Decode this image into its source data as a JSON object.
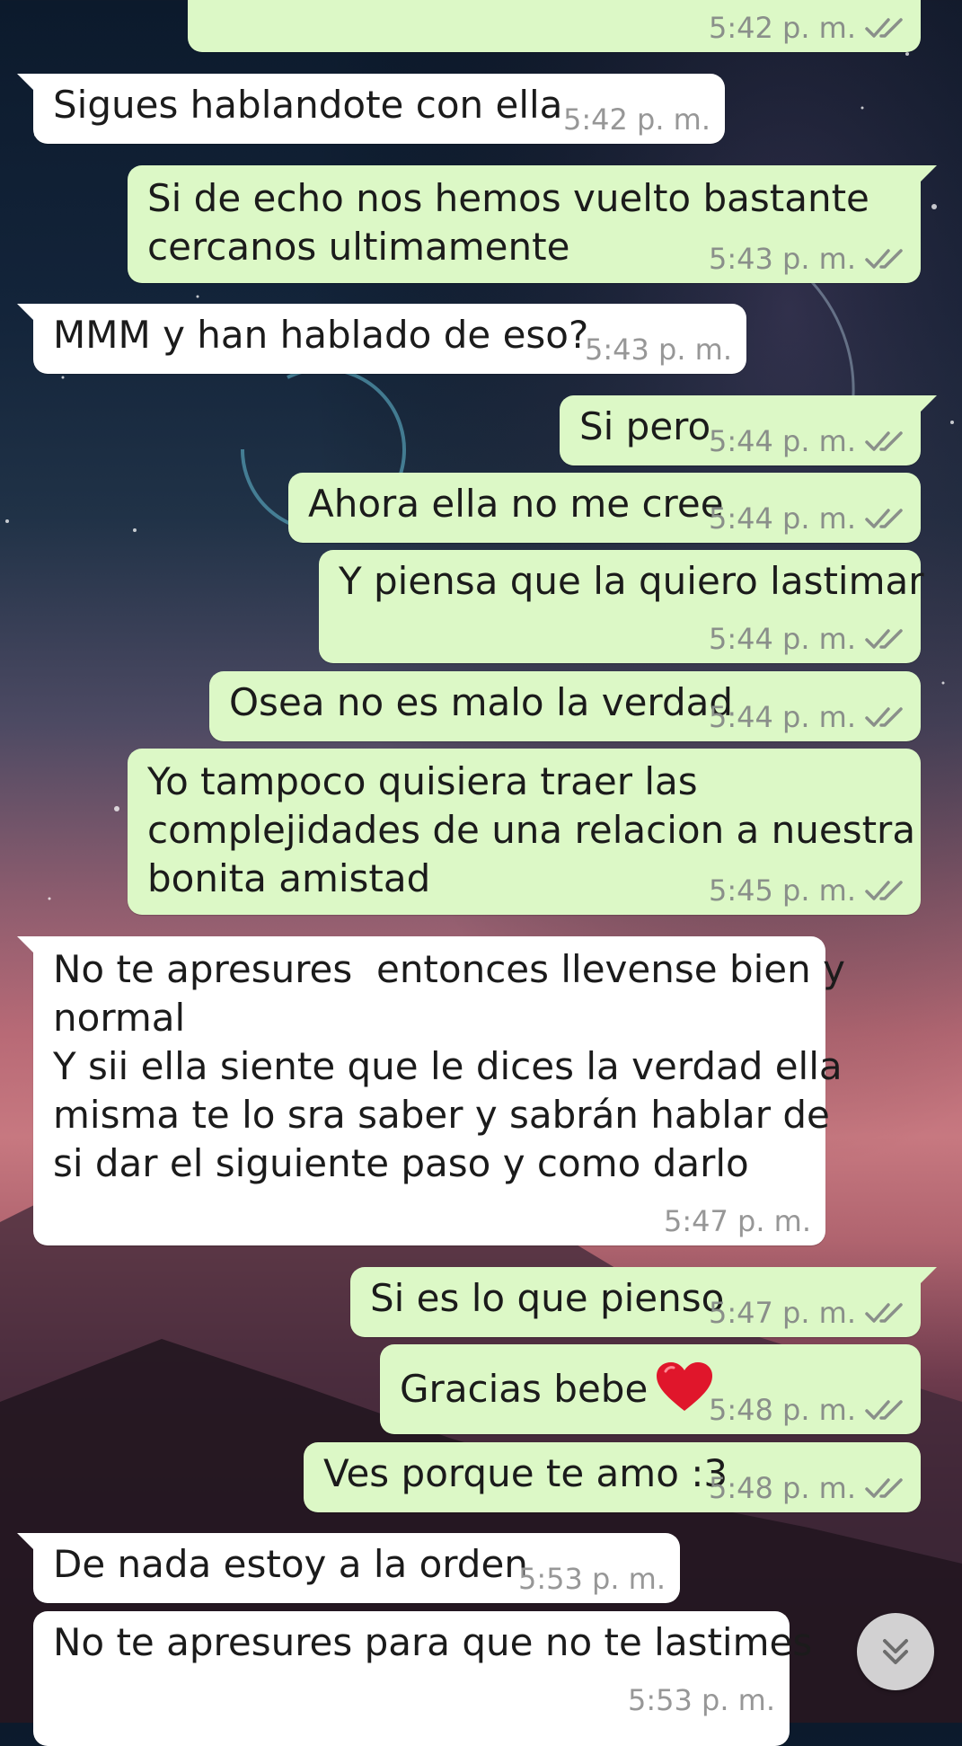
{
  "messages": [
    {
      "text": "",
      "time": "5:42 p. m."
    },
    {
      "text": "Sigues hablandote con ella",
      "time": "5:42 p. m."
    },
    {
      "text": "Si de echo nos hemos vuelto bastante\ncercanos ultimamente",
      "time": "5:43 p. m."
    },
    {
      "text": "MMM y han hablado de eso?",
      "time": "5:43 p. m."
    },
    {
      "text": "Si pero",
      "time": "5:44 p. m."
    },
    {
      "text": "Ahora ella no me cree",
      "time": "5:44 p. m."
    },
    {
      "text": "Y piensa que la quiero lastimar",
      "time": "5:44 p. m."
    },
    {
      "text": "Osea no es malo la verdad",
      "time": "5:44 p. m."
    },
    {
      "text": "Yo tampoco quisiera traer las\ncomplejidades de una relacion a nuestra\nbonita amistad",
      "time": "5:45 p. m."
    },
    {
      "text": "No te apresures  entonces llevense bien y\nnormal\nY sii ella siente que le dices la verdad ella\nmisma te lo sra saber y sabrán hablar de\nsi dar el siguiente paso y como darlo",
      "time": "5:47 p. m."
    },
    {
      "text": "Si es lo que pienso",
      "time": "5:47 p. m."
    },
    {
      "text": "Gracias bebe",
      "emoji": "red-heart",
      "time": "5:48 p. m."
    },
    {
      "text": "Ves porque te amo :3",
      "time": "5:48 p. m."
    },
    {
      "text": "De nada estoy a la orden",
      "time": "5:53 p. m."
    },
    {
      "text": "No te apresures para que no te lastimes",
      "time": "5:53 p. m."
    }
  ],
  "icons": {
    "read_receipt": "double-check-icon",
    "scroll_down": "chevron-double-down-icon"
  },
  "colors": {
    "outgoing_bubble": "#dcf8c6",
    "incoming_bubble": "#ffffff",
    "timestamp": "#8a8f8a"
  }
}
